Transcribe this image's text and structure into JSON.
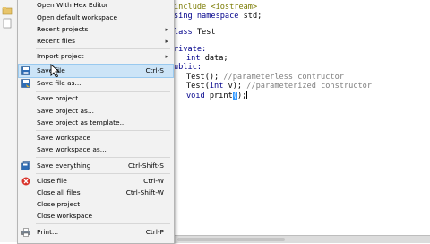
{
  "menu": {
    "items": [
      {
        "label": "Open With Hex Editor"
      },
      {
        "label": "Open default workspace"
      },
      {
        "label": "Recent projects",
        "submenu": true
      },
      {
        "label": "Recent files",
        "submenu": true
      },
      {
        "label": "Import project",
        "submenu": true
      },
      {
        "label": "Save file",
        "shortcut": "Ctrl-S",
        "highlighted": true,
        "icon": "save-icon"
      },
      {
        "label": "Save file as...",
        "icon": "save-as-icon"
      },
      {
        "label": "Save project"
      },
      {
        "label": "Save project as..."
      },
      {
        "label": "Save project as template..."
      },
      {
        "label": "Save workspace"
      },
      {
        "label": "Save workspace as..."
      },
      {
        "label": "Save everything",
        "shortcut": "Ctrl-Shift-S",
        "icon": "save-all-icon"
      },
      {
        "label": "Close file",
        "shortcut": "Ctrl-W",
        "icon": "close-file-icon"
      },
      {
        "label": "Close all files",
        "shortcut": "Ctrl-Shift-W"
      },
      {
        "label": "Close project"
      },
      {
        "label": "Close workspace"
      },
      {
        "label": "Print...",
        "shortcut": "Ctrl-P",
        "icon": "print-icon"
      }
    ]
  },
  "editor": {
    "lines": [
      [
        "include ",
        "<iostream>"
      ],
      [
        "sing ",
        "namespace ",
        "std;"
      ],
      [
        "lass ",
        "Test"
      ],
      [
        "rivate:"
      ],
      [
        "int ",
        "data;"
      ],
      [
        "ublic:"
      ],
      [
        "Test(); ",
        "//parameterless contructor"
      ],
      [
        "Test(",
        "int ",
        "v); ",
        "//parameterized constructor"
      ],
      [
        "void ",
        "print",
        "(",
        ");"
      ]
    ]
  },
  "colors": {
    "menu_highlight": "#cce4f7",
    "keyword": "#00008b",
    "comment": "#808080",
    "preprocessor": "#7a7a00"
  }
}
